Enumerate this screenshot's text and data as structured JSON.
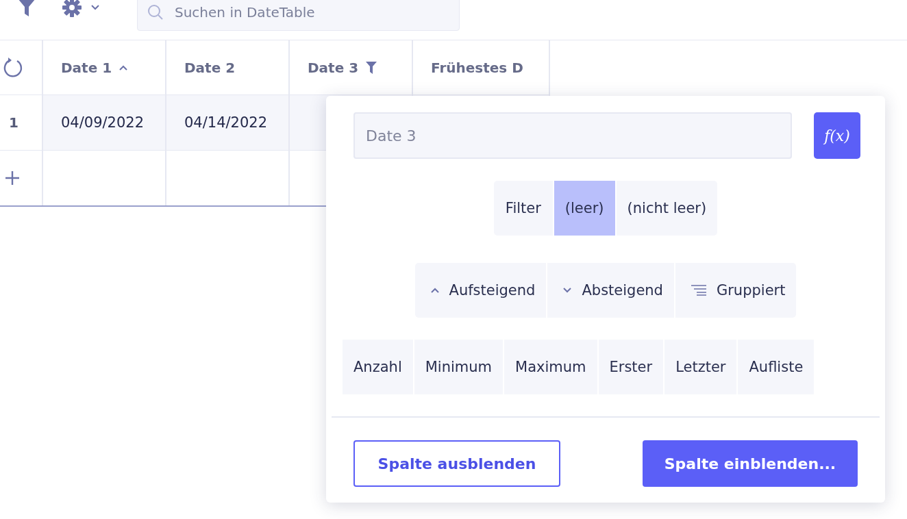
{
  "toolbar": {
    "search": {
      "placeholder": "Suchen in DateTable"
    }
  },
  "table": {
    "columns": [
      {
        "label": "Date 1",
        "sort_ascending": true,
        "filtered": false
      },
      {
        "label": "Date 2",
        "sort_ascending": false,
        "filtered": false
      },
      {
        "label": "Date 3",
        "sort_ascending": false,
        "filtered": true
      },
      {
        "label": "Frühestes D",
        "sort_ascending": false,
        "filtered": false
      }
    ],
    "rows": [
      {
        "number": "1",
        "cells": [
          "04/09/2022",
          "04/14/2022",
          "",
          ""
        ]
      }
    ]
  },
  "column_menu": {
    "name_field": {
      "placeholder": "Date 3"
    },
    "formula_button": "f(x)",
    "filter": {
      "label": "Filter",
      "options": [
        {
          "label": "(leer)",
          "selected": true
        },
        {
          "label": "(nicht leer)",
          "selected": false
        }
      ]
    },
    "sort": [
      {
        "label": "Aufsteigend",
        "kind": "asc"
      },
      {
        "label": "Absteigend",
        "kind": "desc"
      },
      {
        "label": "Gruppiert",
        "kind": "group"
      }
    ],
    "aggregations": [
      {
        "label": "Anzahl",
        "selected": false
      },
      {
        "label": "Minimum",
        "selected": false
      },
      {
        "label": "Maximum",
        "selected": false
      },
      {
        "label": "Erster",
        "selected": false
      },
      {
        "label": "Letzter",
        "selected": false
      },
      {
        "label": "Aufliste",
        "selected": false
      }
    ],
    "hide_button": "Spalte ausblenden",
    "show_button": "Spalte einblenden..."
  }
}
